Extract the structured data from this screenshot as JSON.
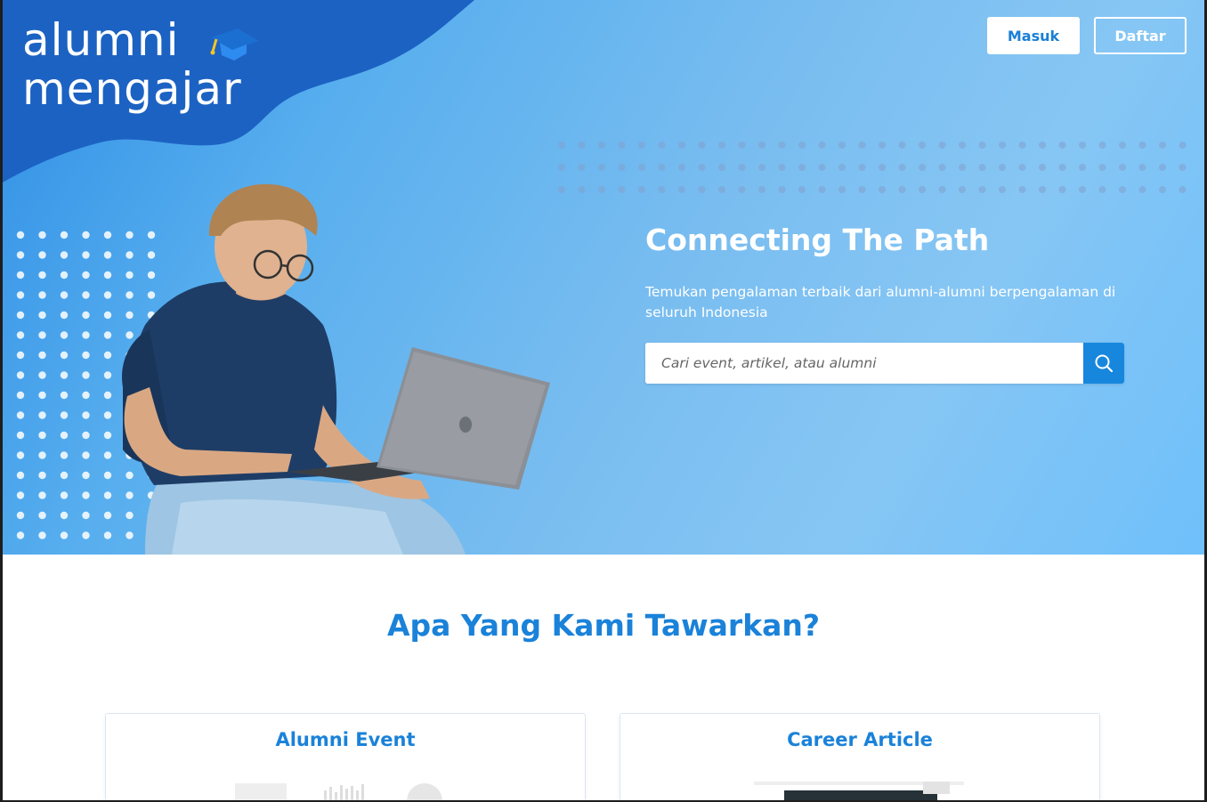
{
  "header": {
    "logo_line1": "alumni",
    "logo_line2": "mengajar",
    "login_label": "Masuk",
    "register_label": "Daftar"
  },
  "hero": {
    "title": "Connecting The Path",
    "subtitle": "Temukan pengalaman terbaik dari alumni-alumni berpengalaman di seluruh Indonesia",
    "search_placeholder": "Cari event, artikel, atau alumni"
  },
  "offerings": {
    "title": "Apa Yang Kami Tawarkan?",
    "cards": [
      {
        "label": "Alumni Event"
      },
      {
        "label": "Career Article"
      }
    ]
  },
  "colors": {
    "brand_blue": "#1a82d9",
    "logo_blob": "#1c62c3",
    "search_button": "#1787dd"
  },
  "icons": {
    "search": "search-icon",
    "graduation_cap": "graduation-cap-icon"
  }
}
